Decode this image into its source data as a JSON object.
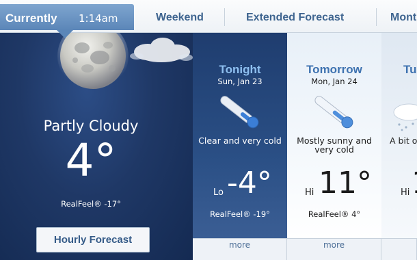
{
  "tabs": {
    "current_label": "Currently",
    "current_time": "1:14am",
    "weekend": "Weekend",
    "extended": "Extended Forecast",
    "month": "Month"
  },
  "current": {
    "condition": "Partly Cloudy",
    "temp": "4°",
    "realfeel": "RealFeel® -17°",
    "hourly_button": "Hourly Forecast"
  },
  "forecast": [
    {
      "title": "Tonight",
      "date": "Sun, Jan 23",
      "desc": "Clear and very cold",
      "hilo": "Lo",
      "temp": "-4°",
      "realfeel": "RealFeel® -19°",
      "more": "more"
    },
    {
      "title": "Tomorrow",
      "date": "Mon, Jan 24",
      "desc": "Mostly sunny and very cold",
      "hilo": "Hi",
      "temp": "11°",
      "realfeel": "RealFeel® 4°",
      "more": "more"
    },
    {
      "title": "Tu",
      "desc": "A bit o",
      "hilo": "Hi",
      "temp": "1"
    }
  ],
  "colors": {
    "tab_active": "#5b86b8",
    "tab_text": "#3f6590",
    "night_panel": "#1f3866",
    "tonight_title": "#8fc0f0",
    "tomorrow_title": "#3e72b0"
  },
  "icons": [
    "moon-icon",
    "cloud-icon",
    "thermometer-icon"
  ]
}
